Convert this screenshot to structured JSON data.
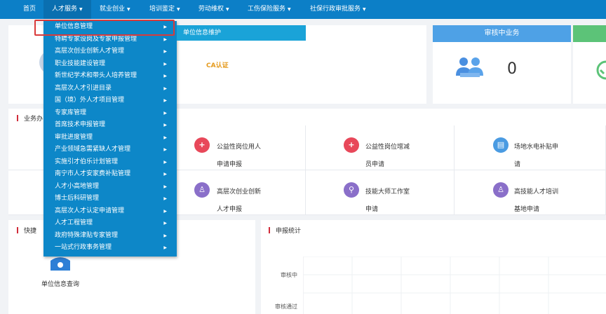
{
  "nav": {
    "home": "首页",
    "talent": "人才服务",
    "employment": "就业创业",
    "training": "培训鉴定",
    "labor": "劳动维权",
    "injury": "工伤保险服务",
    "approval": "社保行政审批服务"
  },
  "dropdown": {
    "items": [
      "单位信息管理",
      "特聘专家设岗及专家申报管理",
      "高层次创业创新人才管理",
      "职业技能建设管理",
      "新世纪学术和带头人培养管理",
      "高层次人才引进目录",
      "国（境）外人才项目管理",
      "专家库管理",
      "首席技术申报管理",
      "审批进度管理",
      "产业领域急需紧缺人才管理",
      "实施引才伯乐计划管理",
      "南宁市人才安家费补贴管理",
      "人才小高地管理",
      "博士后科研管理",
      "高层次人才认定申请管理",
      "人才工程管理",
      "政府特殊津贴专家管理",
      "一站式行政事务管理"
    ],
    "submenu": "单位信息维护"
  },
  "top_panel": {
    "ca_label": "CA认证",
    "review_title": "审核中业务",
    "review_count": "0"
  },
  "business": {
    "title": "业务办",
    "items": [
      {
        "line1": "公益性岗位用人",
        "line2": "申请申报",
        "icon": "user-plus-icon",
        "color": "#e8485a"
      },
      {
        "line1": "公益性岗位增减",
        "line2": "员申请",
        "icon": "user-plus-icon",
        "color": "#e8485a"
      },
      {
        "line1": "场地水电补贴申",
        "line2": "请",
        "icon": "card-icon",
        "color": "#4a9be2"
      },
      {
        "line1": "高层次创业创新",
        "line2": "人才申报",
        "icon": "person-icon",
        "color": "#8a6fc9"
      },
      {
        "line1": "技能大师工作室",
        "line2": "申请",
        "icon": "search-icon",
        "color": "#8a6fc9"
      },
      {
        "line1": "高技能人才培训",
        "line2": "基地申请",
        "icon": "person-icon",
        "color": "#8a6fc9"
      }
    ]
  },
  "quick": {
    "title": "快捷",
    "unit_query": "单位信息查询"
  },
  "stats": {
    "title": "申报统计",
    "labels": [
      "审核中",
      "审核通过"
    ]
  }
}
